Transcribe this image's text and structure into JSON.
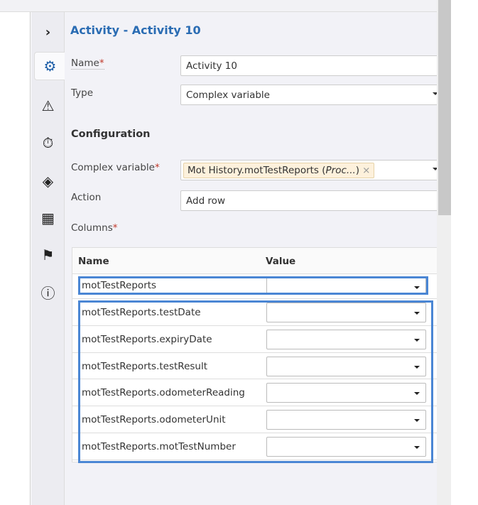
{
  "header": {
    "title": "Activity  - Activity 10"
  },
  "rail": {
    "items": [
      "expand",
      "settings",
      "alerts",
      "timer",
      "forms",
      "checkered-flag",
      "flag",
      "info"
    ]
  },
  "form": {
    "name_label": "Name",
    "name_value": "Activity 10",
    "type_label": "Type",
    "type_value": "Complex variable",
    "config_heading": "Configuration",
    "complex_label": "Complex variable",
    "complex_tag": "Mot History.motTestReports (",
    "complex_tag_italic": "Proc...",
    "complex_tag_end": ")",
    "complex_tag_remove": "×",
    "action_label": "Action",
    "action_value": "Add row",
    "columns_label": "Columns",
    "required_mark": "*"
  },
  "table": {
    "headers": [
      "Name",
      "Value"
    ],
    "rows": [
      {
        "name": "motTestReports",
        "value": ""
      },
      {
        "name": "motTestReports.testDate",
        "value": ""
      },
      {
        "name": "motTestReports.expiryDate",
        "value": ""
      },
      {
        "name": "motTestReports.testResult",
        "value": ""
      },
      {
        "name": "motTestReports.odometerReading",
        "value": ""
      },
      {
        "name": "motTestReports.odometerUnit",
        "value": ""
      },
      {
        "name": "motTestReports.motTestNumber",
        "value": ""
      }
    ]
  },
  "colors": {
    "accent": "#2a6cb3",
    "highlight": "#4a86d4",
    "required": "#c0392b"
  }
}
